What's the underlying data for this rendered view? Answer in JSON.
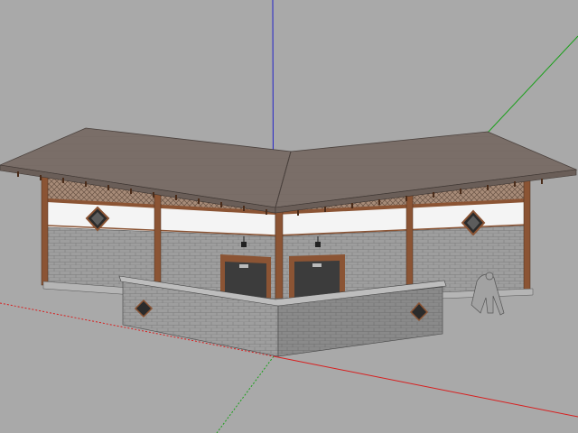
{
  "viewport": {
    "background": "#a9a9a9",
    "axis_colors": {
      "x": "#d81f1f",
      "y": "#1aa01a",
      "z": "#2323c8"
    }
  },
  "model": {
    "roof_color": "#786c66",
    "roof_edge_color": "#5c524d",
    "wall_plaster_color": "#f4f4f4",
    "brick_color": "#9c9c9c",
    "timber_color": "#8b5434",
    "door_color": "#3c3c3c",
    "icons": [
      "diamond-window-icon",
      "lantern-icon",
      "scale-figure-icon"
    ]
  }
}
